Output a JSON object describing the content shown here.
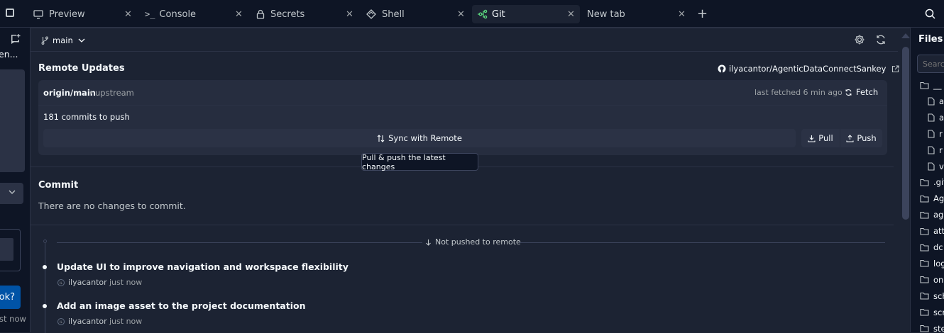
{
  "tabs": [
    {
      "label": "Preview",
      "icon": "monitor-icon"
    },
    {
      "label": "Console",
      "icon": "terminal-icon"
    },
    {
      "label": "Secrets",
      "icon": "lock-icon"
    },
    {
      "label": "Shell",
      "icon": "shell-icon"
    },
    {
      "label": "Git",
      "icon": "git-branch-icon",
      "active": true
    },
    {
      "label": "New tab"
    }
  ],
  "files_panel": {
    "title": "Files",
    "search_placeholder": "Search",
    "tree": [
      "__",
      "a",
      "a",
      "r",
      "r",
      "v",
      ".git",
      "Ag",
      "age",
      "att",
      "dc",
      "log",
      "on",
      "sch",
      "scr",
      "ste"
    ]
  },
  "left_panel": {
    "truncated_text": "en...",
    "button_label": "ok?",
    "timestamp": "st now"
  },
  "git": {
    "branch": "main",
    "remote_updates": {
      "title": "Remote Updates",
      "repo": "ilyacantor/AgenticDataConnectSankey",
      "remote_branch": "origin/main",
      "upstream_label": "upstream",
      "last_fetched": "last fetched 6 min ago",
      "fetch_label": "Fetch",
      "commits_to_push": "181 commits to push",
      "sync_label": "Sync with Remote",
      "pull_label": "Pull",
      "push_label": "Push",
      "tooltip": "Pull & push the latest changes"
    },
    "commit": {
      "title": "Commit",
      "empty_message": "There are no changes to commit."
    },
    "history": {
      "separator": "Not pushed to remote",
      "commits": [
        {
          "message": "Update UI to improve navigation and workspace flexibility",
          "author": "ilyacantor",
          "avatar": "IL",
          "time": "just now"
        },
        {
          "message": "Add an image asset to the project documentation",
          "author": "ilyacantor",
          "avatar": "IL",
          "time": "just now"
        }
      ]
    }
  },
  "colors": {
    "background": "#1c2333",
    "topbar": "#0e1525",
    "card": "#262d3f",
    "accent_blue": "#0053a6",
    "git_green": "#5bd67f"
  }
}
